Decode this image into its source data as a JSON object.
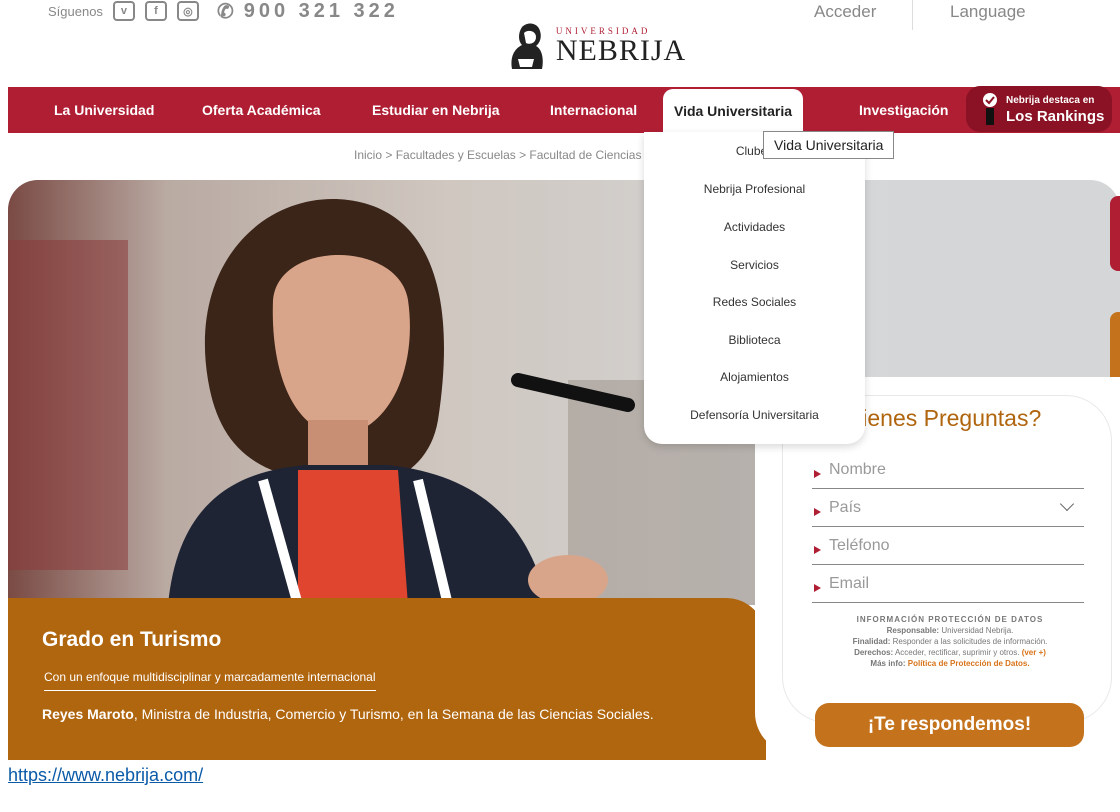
{
  "topbar": {
    "follow_label": "Síguenos",
    "phone": "900 321 322",
    "acceder": "Acceder",
    "language": "Language"
  },
  "logo": {
    "small": "UNIVERSIDAD",
    "big": "NEBRIJA"
  },
  "nav": {
    "items": [
      {
        "label": "La Universidad"
      },
      {
        "label": "Oferta Académica"
      },
      {
        "label": "Estudiar en Nebrija"
      },
      {
        "label": "Internacional"
      },
      {
        "label": "Vida Universitaria"
      },
      {
        "label": "Investigación"
      }
    ],
    "ranking": {
      "small": "Nebrija destaca en",
      "big": "Los Rankings"
    }
  },
  "breadcrumb": "Inicio > Facultades y Escuelas > Facultad de Ciencias Sociales",
  "dropdown": {
    "items": [
      {
        "label": "Clubes"
      },
      {
        "label": "Nebrija Profesional"
      },
      {
        "label": "Actividades"
      },
      {
        "label": "Servicios"
      },
      {
        "label": "Redes Sociales"
      },
      {
        "label": "Biblioteca"
      },
      {
        "label": "Alojamientos"
      },
      {
        "label": "Defensoría Universitaria"
      }
    ],
    "tooltip": "Vida Universitaria"
  },
  "hero": {
    "title": "Grado en Turismo",
    "subtitle": "Con un enfoque multidisciplinar y marcadamente internacional",
    "desc_name": "Reyes Maroto",
    "desc_rest": ", Ministra de Industria, Comercio y Turismo, en la Semana de las Ciencias Sociales."
  },
  "form": {
    "title": "¿Tienes Preguntas?",
    "fields": {
      "nombre": "Nombre",
      "pais": "País",
      "telefono": "Teléfono",
      "email": "Email"
    },
    "privacy": {
      "title": "INFORMACIÓN PROTECCIÓN DE DATOS",
      "responsable_k": "Responsable:",
      "responsable_v": "Universidad Nebrija.",
      "finalidad_k": "Finalidad:",
      "finalidad_v": "Responder a las solicitudes de información.",
      "derechos_k": "Derechos:",
      "derechos_v": "Acceder, rectificar, suprimir y otros.",
      "ver_mas": "(ver +)",
      "mas_info_k": "Más info:",
      "mas_info_v": "Política de Protección de Datos."
    },
    "submit": "¡Te respondemos!"
  },
  "url": "https://www.nebrija.com/",
  "colors": {
    "brand_red": "#b01e34",
    "orange": "#b0650f",
    "button_orange": "#c4721c"
  }
}
